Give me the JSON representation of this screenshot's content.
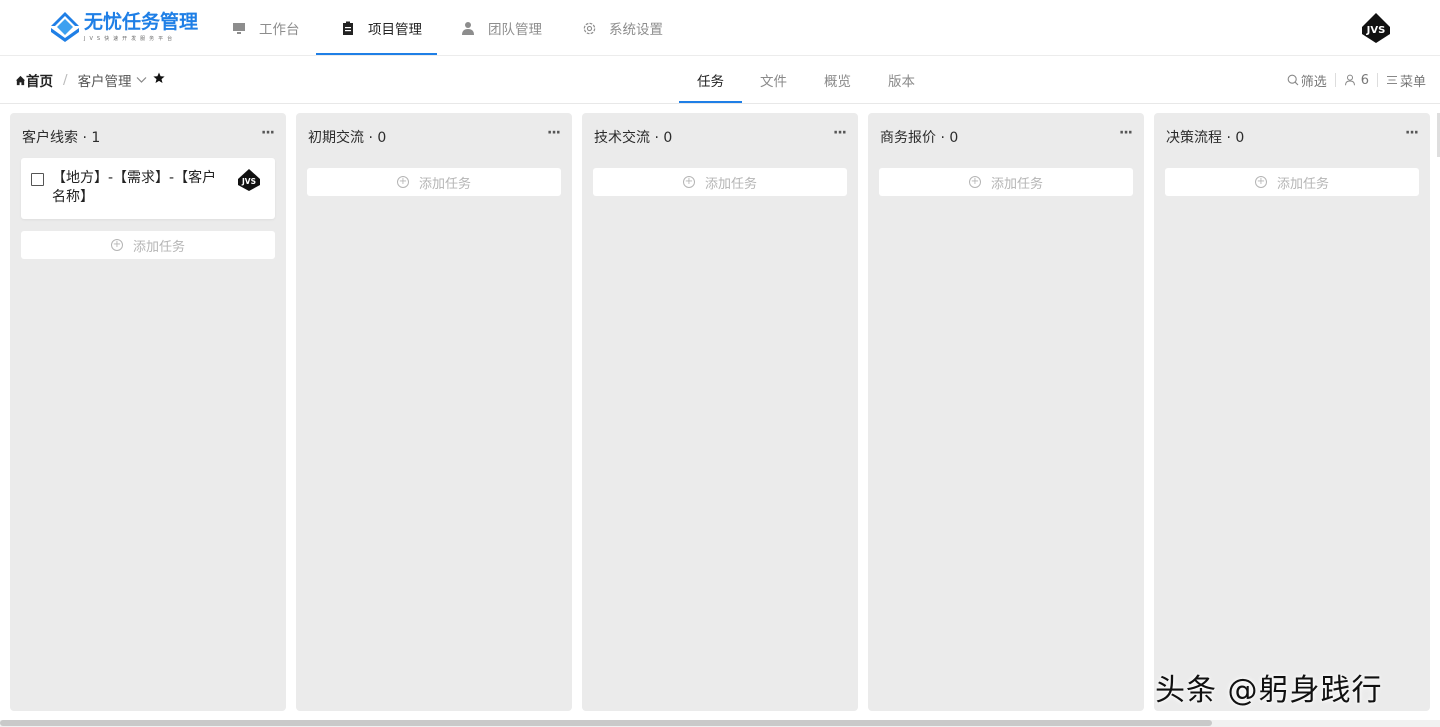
{
  "app": {
    "logo_title": "无忧任务管理",
    "logo_subtitle": "JVS快速开发服务平台",
    "avatar_text": "JVS"
  },
  "nav": {
    "items": [
      {
        "label": "工作台",
        "icon": "monitor-icon",
        "active": false
      },
      {
        "label": "项目管理",
        "icon": "clipboard-icon",
        "active": true
      },
      {
        "label": "团队管理",
        "icon": "user-icon",
        "active": false
      },
      {
        "label": "系统设置",
        "icon": "gear-icon",
        "active": false
      }
    ]
  },
  "breadcrumb": {
    "home": "首页",
    "separator": "/",
    "current": "客户管理"
  },
  "tabs": [
    {
      "label": "任务",
      "active": true
    },
    {
      "label": "文件",
      "active": false
    },
    {
      "label": "概览",
      "active": false
    },
    {
      "label": "版本",
      "active": false
    }
  ],
  "tools": {
    "filter": "筛选",
    "members": "6",
    "menu": "菜单"
  },
  "board": {
    "add_task_label": "添加任务",
    "columns": [
      {
        "title": "客户线索 · 1",
        "cards": [
          {
            "title": "【地方】-【需求】-【客户名称】"
          }
        ]
      },
      {
        "title": "初期交流 · 0",
        "cards": []
      },
      {
        "title": "技术交流 · 0",
        "cards": []
      },
      {
        "title": "商务报价 · 0",
        "cards": []
      },
      {
        "title": "决策流程 · 0",
        "cards": []
      }
    ]
  },
  "watermark": "头条 @躬身践行",
  "colors": {
    "accent": "#1f7fe6",
    "column_bg": "#ebebeb"
  }
}
